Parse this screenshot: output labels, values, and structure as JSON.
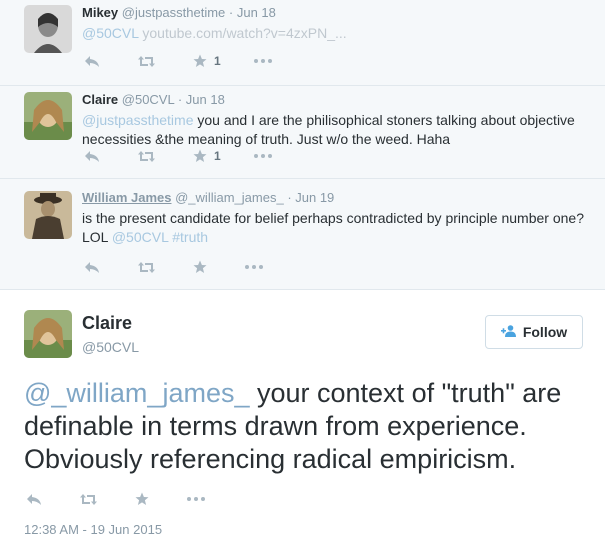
{
  "replies": [
    {
      "name": "Mikey",
      "handle": "@justpassthetime",
      "date": "· Jun 18",
      "mention": "@50CVL",
      "text": " youtube.com/watch?v=4zxPN_...",
      "favorites": "1"
    },
    {
      "name": "Claire",
      "handle": "@50CVL",
      "date": "· Jun 18",
      "mention": "@justpassthetime",
      "text": " you and I are the philisophical stoners talking about objective necessities &the meaning of truth. Just w/o the weed. Haha",
      "favorites": "1"
    },
    {
      "name": "William James",
      "handle": "@_william_james_",
      "date": "· Jun 19",
      "text": "is the present candidate for belief perhaps contradicted by principle number one? LOL ",
      "mention": "@50CVL",
      "hashtag": "#truth",
      "favorites": ""
    }
  ],
  "main": {
    "name": "Claire",
    "handle": "@50CVL",
    "follow_label": "Follow",
    "mention": "@_william_james_",
    "text": " your context of \"truth\" are definable in terms drawn from experience. Obviously referencing radical empiricism.",
    "timestamp": "12:38 AM - 19 Jun 2015"
  },
  "colors": {
    "thread_bg": "#f5f8fa",
    "mention": "#a8c8e0",
    "border": "#e1e8ed",
    "action_icon": "#aab8c2"
  },
  "icons": [
    "reply-icon",
    "retweet-icon",
    "favorite-icon",
    "more-icon",
    "follow-person-icon"
  ]
}
